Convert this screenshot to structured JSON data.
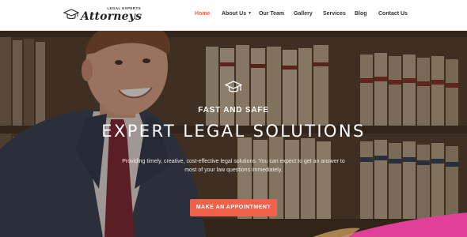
{
  "logo": {
    "small_text": "LEGAL EXPERTS",
    "main_text": "Attorneys",
    "icon": "graduation-cap-icon"
  },
  "nav": {
    "items": [
      {
        "label": "Home",
        "active": true
      },
      {
        "label": "About Us",
        "has_dropdown": true
      },
      {
        "label": "Our Team"
      },
      {
        "label": "Gallery"
      },
      {
        "label": "Services"
      },
      {
        "label": "Blog"
      },
      {
        "label": "Contact Us"
      }
    ]
  },
  "hero": {
    "icon": "graduation-cap-icon",
    "tagline": "FAST AND SAFE",
    "headline": "EXPERT LEGAL SOLUTIONS",
    "description": "Providing timely, creative, cost-effective legal solutions. You can expect to get an answer to most of your law questions immediately.",
    "cta_label": "MAKE AN APPOINTMENT"
  },
  "colors": {
    "accent": "#f0614b",
    "nav_text": "#333333",
    "pink_accent": "#e0409a"
  }
}
